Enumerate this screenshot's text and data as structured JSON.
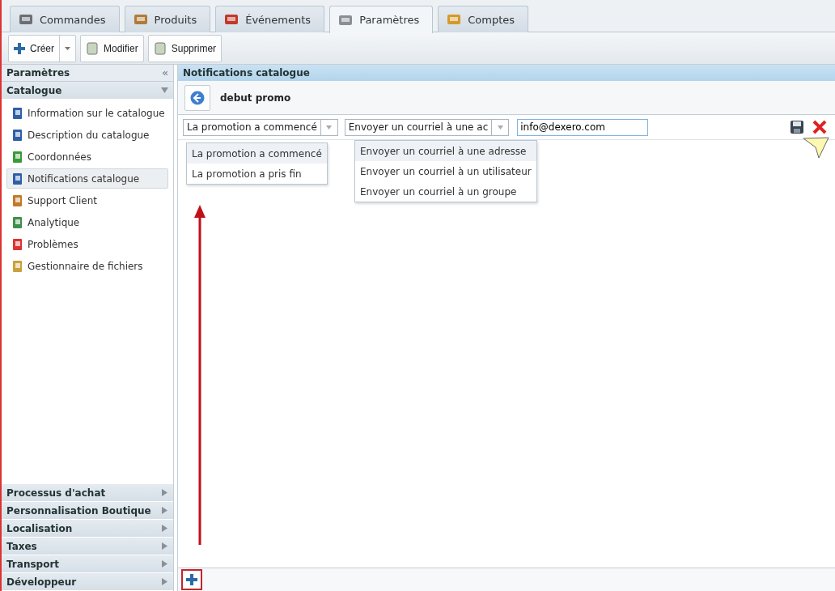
{
  "tabs": [
    {
      "label": "Commandes",
      "selected": false
    },
    {
      "label": "Produits",
      "selected": false
    },
    {
      "label": "Événements",
      "selected": false
    },
    {
      "label": "Paramètres",
      "selected": true
    },
    {
      "label": "Comptes",
      "selected": false
    }
  ],
  "toolbar": {
    "buttons": [
      {
        "kind": "split",
        "label": "Créer"
      },
      {
        "kind": "plain",
        "label": "Modifier"
      },
      {
        "kind": "plain",
        "label": "Supprimer"
      }
    ]
  },
  "sidebar": {
    "title": "Paramètres",
    "collapse_glyph": "«",
    "sections": [
      {
        "title": "Catalogue",
        "expanded": true,
        "items": [
          {
            "label": "Information sur le catalogue",
            "selected": false
          },
          {
            "label": "Description du catalogue",
            "selected": false
          },
          {
            "label": "Coordonnées",
            "selected": false
          },
          {
            "label": "Notifications catalogue",
            "selected": true
          },
          {
            "label": "Support Client",
            "selected": false
          },
          {
            "label": "Analytique",
            "selected": false
          },
          {
            "label": "Problèmes",
            "selected": false
          },
          {
            "label": "Gestionnaire de fichiers",
            "selected": false
          }
        ]
      },
      {
        "title": "Processus d'achat",
        "expanded": false
      },
      {
        "title": "Personnalisation Boutique",
        "expanded": false
      },
      {
        "title": "Localisation",
        "expanded": false
      },
      {
        "title": "Taxes",
        "expanded": false
      },
      {
        "title": "Transport",
        "expanded": false
      },
      {
        "title": "Développeur",
        "expanded": false
      }
    ]
  },
  "main": {
    "title": "Notifications catalogue",
    "record_title": "debut promo",
    "event_combo": {
      "value": "La promotion a commencé",
      "options": [
        {
          "label": "La promotion a commencé",
          "selected": true
        },
        {
          "label": "La promotion a pris fin",
          "selected": false
        }
      ]
    },
    "action_combo": {
      "value": "Envoyer un courriel à une ac",
      "options": [
        {
          "label": "Envoyer un courriel à une adresse",
          "selected": true
        },
        {
          "label": "Envoyer un courriel à un utilisateur",
          "selected": false
        },
        {
          "label": "Envoyer un courriel à un groupe",
          "selected": false
        }
      ]
    },
    "email_field": {
      "value": "info@dexero.com"
    }
  }
}
